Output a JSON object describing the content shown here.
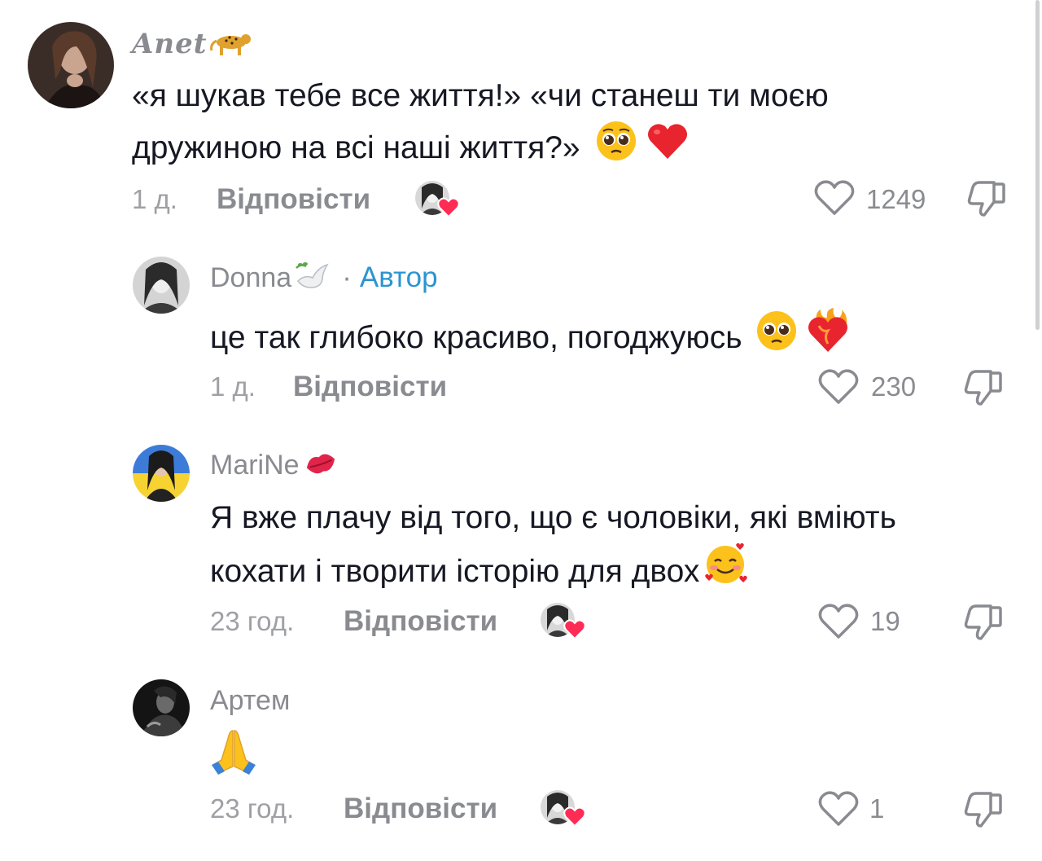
{
  "comments": [
    {
      "username": "Anet",
      "text_line1": "«я шукав тебе все життя!» «чи станеш ти моєю",
      "text_line2": "дружиною на всі наші життя?»",
      "time": "1 д.",
      "reply_label": "Відповісти",
      "likes": "1249",
      "emojis": [
        "pleading-face",
        "red-heart"
      ]
    },
    {
      "username": "Donna",
      "separator": "·",
      "author_label": "Автор",
      "text_line1": "це так глибоко красиво, погоджуюсь",
      "time": "1 д.",
      "reply_label": "Відповісти",
      "likes": "230",
      "emojis": [
        "pleading-face",
        "heart-on-fire"
      ]
    },
    {
      "username": "MariNe",
      "text_line1": "Я вже плачу від того, що є чоловіки, які вміють",
      "text_line2": "кохати і творити історію для двох",
      "time": "23 год.",
      "reply_label": "Відповісти",
      "likes": "19",
      "emojis": [
        "smiling-face-with-hearts"
      ]
    },
    {
      "username": "Артем",
      "text_line1": "",
      "time": "23 год.",
      "reply_label": "Відповісти",
      "likes": "1",
      "emojis": [
        "folded-hands"
      ]
    }
  ],
  "colors": {
    "text": "#161823",
    "muted": "#8a8b91",
    "author": "#2b95d1",
    "heart": "#fe2c55"
  }
}
